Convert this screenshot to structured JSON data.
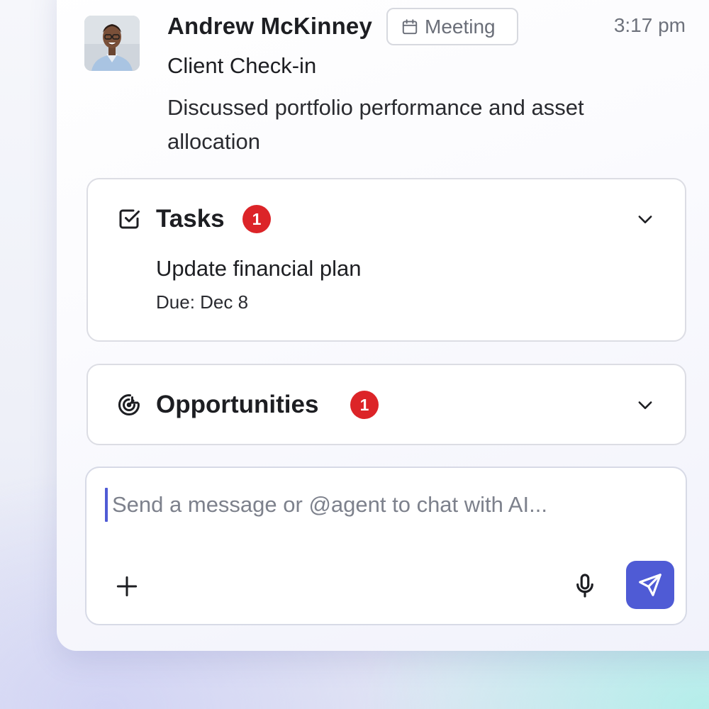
{
  "message": {
    "sender": "Andrew McKinney",
    "type_label": "Meeting",
    "type_icon": "calendar-icon",
    "time": "3:17 pm",
    "subject": "Client Check-in",
    "summary": "Discussed portfolio performance and asset allocation"
  },
  "tasks": {
    "title": "Tasks",
    "icon": "checkbox-icon",
    "count": "1",
    "items": [
      {
        "title": "Update financial plan",
        "due": "Due: Dec 8"
      }
    ]
  },
  "opportunities": {
    "title": "Opportunities",
    "icon": "target-icon",
    "count": "1"
  },
  "composer": {
    "placeholder": "Send a message or @agent to chat with AI...",
    "value": ""
  },
  "colors": {
    "accent": "#4f5bd5",
    "badge": "#dc2428"
  }
}
